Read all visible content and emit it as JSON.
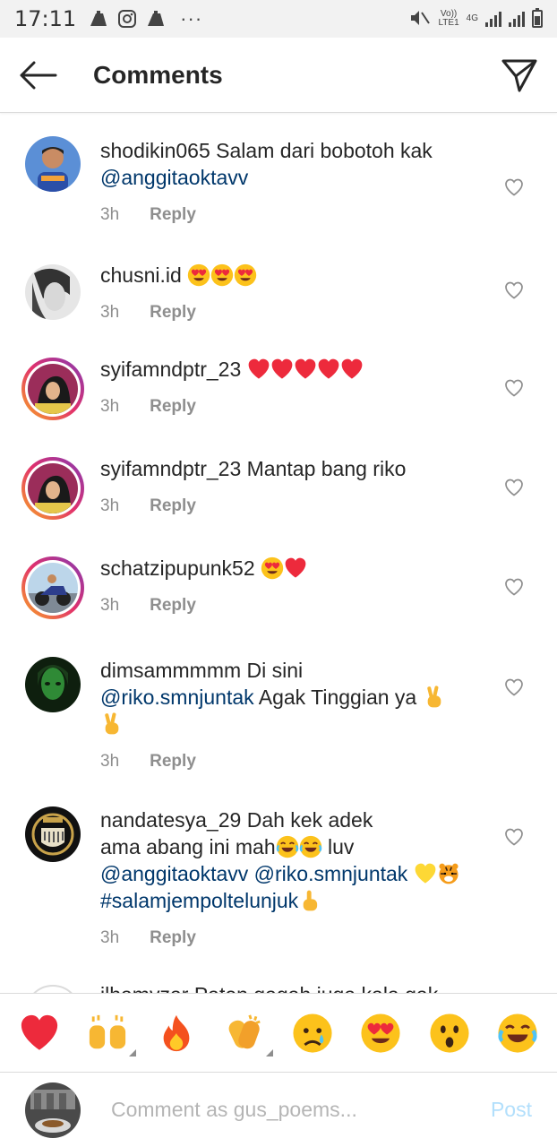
{
  "status_bar": {
    "time": "17:11",
    "dots": "···",
    "volte": "Vo))",
    "lte": "LTE1",
    "network": "4G"
  },
  "header": {
    "title": "Comments",
    "back_icon": "arrow-left-icon",
    "share_icon": "paper-plane-icon"
  },
  "comments": [
    {
      "username": "shodikin065",
      "text": "Salam dari bobotoh kak",
      "mention_line": "@anggitaoktavv",
      "time": "3h",
      "reply": "Reply"
    },
    {
      "username": "chusni.id",
      "text": "",
      "emojis": [
        "heart-eyes",
        "heart-eyes",
        "heart-eyes"
      ],
      "time": "3h",
      "reply": "Reply"
    },
    {
      "username": "syifamndptr_23",
      "text": "",
      "emojis": [
        "red-heart",
        "red-heart",
        "red-heart",
        "red-heart",
        "red-heart"
      ],
      "time": "3h",
      "reply": "Reply"
    },
    {
      "username": "syifamndptr_23",
      "text": "Mantap bang riko",
      "time": "3h",
      "reply": "Reply"
    },
    {
      "username": "schatzipupunk52",
      "text": "",
      "emojis": [
        "heart-eyes",
        "red-heart"
      ],
      "time": "3h",
      "reply": "Reply"
    },
    {
      "username": "dimsammmmm",
      "text": "Di sini",
      "mention_line": "@riko.smnjuntak",
      "after_mention": "Agak Tinggian ya",
      "emojis": [
        "victory-hand",
        "victory-hand"
      ],
      "time": "3h",
      "reply": "Reply"
    },
    {
      "username": "nandatesya_29",
      "text": "Dah kek adek",
      "line2": "ama abang ini mah",
      "line2_after": "luv",
      "mention_a": "@anggitaoktavv",
      "mention_b": "@riko.smnjuntak",
      "hashtag": "#salamjempoltelunjuk",
      "emojis": [
        "joy",
        "joy",
        "yellow-heart",
        "tiger-face",
        "pointing-up"
      ],
      "time": "3h",
      "reply": "Reply"
    },
    {
      "username": "ilhamyzar",
      "text": "Paten gagah juga kala gak"
    }
  ],
  "emoji_bar": [
    "red-heart",
    "raising-hands",
    "fire",
    "clapping-hands",
    "crying-face",
    "heart-eyes",
    "hushed-face",
    "joy"
  ],
  "composer": {
    "placeholder": "Comment as gus_poems...",
    "post_label": "Post"
  },
  "colors": {
    "text": "#262626",
    "muted": "#8e8e8e",
    "mention": "#00376b",
    "post_disabled": "#b2dffc",
    "heart_red": "#ed2a3c"
  }
}
